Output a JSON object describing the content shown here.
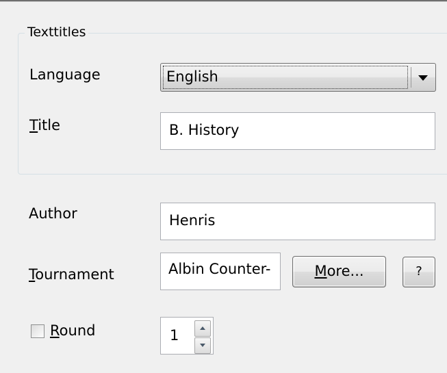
{
  "texttitles": {
    "group_label": "Texttitles",
    "language_label": "Language",
    "language_value": "English",
    "title_label": "Title",
    "title_mnemonic": "T",
    "title_rest": "itle",
    "title_value": "B. History"
  },
  "author": {
    "label": "Author",
    "value": "Henris"
  },
  "tournament": {
    "label": "Tournament",
    "mnemonic": "T",
    "rest": "ournament",
    "value": "Albin Counter-",
    "more_button": "More...",
    "more_mnemonic": "M",
    "more_rest": "ore...",
    "help_button": "?"
  },
  "round": {
    "label": "Round",
    "mnemonic": "R",
    "rest": "ound",
    "checked": false,
    "value": "1"
  },
  "colors": {
    "window_bg": "#f0f0f0",
    "field_border": "#abadb3",
    "group_border": "#d5dfe5"
  },
  "icons": {
    "combo": "chevron-down-icon",
    "spin_up": "spin-up-icon",
    "spin_down": "spin-down-icon"
  }
}
